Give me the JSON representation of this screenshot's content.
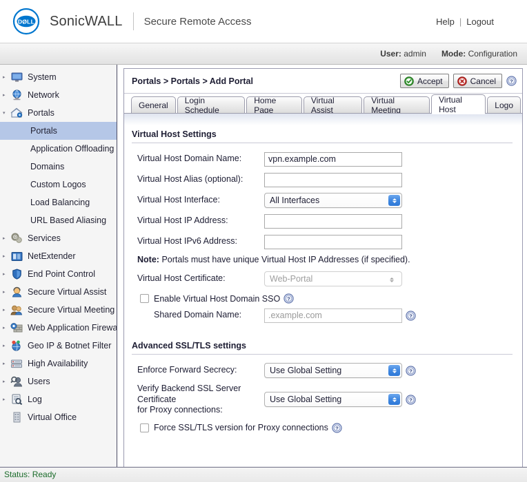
{
  "header": {
    "logo_alt": "Dell",
    "brand": "SonicWALL",
    "product": "Secure Remote Access",
    "help_link": "Help",
    "separator": "|",
    "logout_link": "Logout"
  },
  "mode_bar": {
    "user_key": "User:",
    "user_value": "admin",
    "mode_key": "Mode:",
    "mode_value": "Configuration"
  },
  "sidebar": {
    "items": [
      {
        "label": "System",
        "icon": "monitor-icon",
        "expandable": true
      },
      {
        "label": "Network",
        "icon": "globe-icon",
        "expandable": true
      },
      {
        "label": "Portals",
        "icon": "house-icon",
        "expandable": true,
        "expanded": true
      },
      {
        "label": "Services",
        "icon": "gears-icon",
        "expandable": true
      },
      {
        "label": "NetExtender",
        "icon": "network-adapter-icon",
        "expandable": true
      },
      {
        "label": "End Point Control",
        "icon": "shield-icon",
        "expandable": true
      },
      {
        "label": "Secure Virtual Assist",
        "icon": "person-headset-icon",
        "expandable": true
      },
      {
        "label": "Secure Virtual Meeting",
        "icon": "people-icon",
        "expandable": true
      },
      {
        "label": "Web Application Firewall",
        "icon": "firewall-icon",
        "expandable": true
      },
      {
        "label": "Geo IP & Botnet Filter",
        "icon": "geo-pins-icon",
        "expandable": true
      },
      {
        "label": "High Availability",
        "icon": "servers-icon",
        "expandable": true
      },
      {
        "label": "Users",
        "icon": "users-icon",
        "expandable": true
      },
      {
        "label": "Log",
        "icon": "log-search-icon",
        "expandable": true
      },
      {
        "label": "Virtual Office",
        "icon": "building-icon",
        "expandable": false
      }
    ],
    "portals_children": [
      {
        "label": "Portals",
        "selected": true
      },
      {
        "label": "Application Offloading",
        "selected": false
      },
      {
        "label": "Domains",
        "selected": false
      },
      {
        "label": "Custom Logos",
        "selected": false
      },
      {
        "label": "Load Balancing",
        "selected": false
      },
      {
        "label": "URL Based Aliasing",
        "selected": false
      }
    ]
  },
  "content": {
    "breadcrumb": "Portals > Portals > Add Portal",
    "accept_label": "Accept",
    "cancel_label": "Cancel",
    "tabs": [
      {
        "label": "General",
        "active": false
      },
      {
        "label": "Login Schedule",
        "active": false
      },
      {
        "label": "Home Page",
        "active": false
      },
      {
        "label": "Virtual Assist",
        "active": false
      },
      {
        "label": "Virtual Meeting",
        "active": false
      },
      {
        "label": "Virtual Host",
        "active": true
      },
      {
        "label": "Logo",
        "active": false
      }
    ],
    "virtual_host": {
      "section_title": "Virtual Host Settings",
      "domain_name_label": "Virtual Host Domain Name:",
      "domain_name_value": "vpn.example.com",
      "alias_label": "Virtual Host Alias (optional):",
      "alias_value": "",
      "interface_label": "Virtual Host Interface:",
      "interface_value": "All Interfaces",
      "ip_label": "Virtual Host IP Address:",
      "ip_value": "",
      "ipv6_label": "Virtual Host IPv6 Address:",
      "ipv6_value": "",
      "note_key": "Note:",
      "note_text": "Portals must have unique Virtual Host IP Addresses (if specified).",
      "certificate_label": "Virtual Host Certificate:",
      "certificate_value": "Web-Portal",
      "sso_checkbox_label": "Enable Virtual Host Domain SSO",
      "sso_checked": false,
      "shared_domain_label": "Shared Domain Name:",
      "shared_domain_value": ".example.com"
    },
    "advanced_ssl": {
      "section_title": "Advanced SSL/TLS settings",
      "forward_secrecy_label": "Enforce Forward Secrecy:",
      "forward_secrecy_value": "Use Global Setting",
      "verify_backend_label_line1": "Verify Backend SSL Server Certificate",
      "verify_backend_label_line2": "for Proxy connections:",
      "verify_backend_value": "Use Global Setting",
      "force_version_label": "Force SSL/TLS version for Proxy connections",
      "force_version_checked": false
    }
  },
  "footer": {
    "status_key": "Status:",
    "status_value": "Ready"
  },
  "colors": {
    "dell_blue": "#0076ce",
    "selection_blue": "#b5c7e7",
    "accept_green": "#3a9e35",
    "cancel_red": "#c9302c",
    "status_green": "#1a6b2a",
    "stepper_blue": "#3f87e0"
  }
}
